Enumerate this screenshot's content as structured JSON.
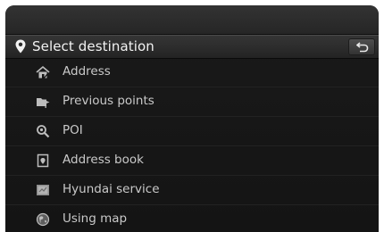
{
  "header": {
    "title": "Select destination",
    "title_icon": "location-pin-icon",
    "back_icon": "back-arrow-icon"
  },
  "menu": {
    "items": [
      {
        "label": "Address",
        "icon": "house-icon"
      },
      {
        "label": "Previous points",
        "icon": "folder-flag-icon"
      },
      {
        "label": "POI",
        "icon": "magnifier-icon"
      },
      {
        "label": "Address book",
        "icon": "book-icon"
      },
      {
        "label": "Hyundai service",
        "icon": "service-icon"
      },
      {
        "label": "Using map",
        "icon": "globe-icon"
      }
    ]
  },
  "colors": {
    "background": "#141414",
    "header": "#2c2c2c",
    "text": "#c9c9c9",
    "title_text": "#f2f2f2"
  }
}
